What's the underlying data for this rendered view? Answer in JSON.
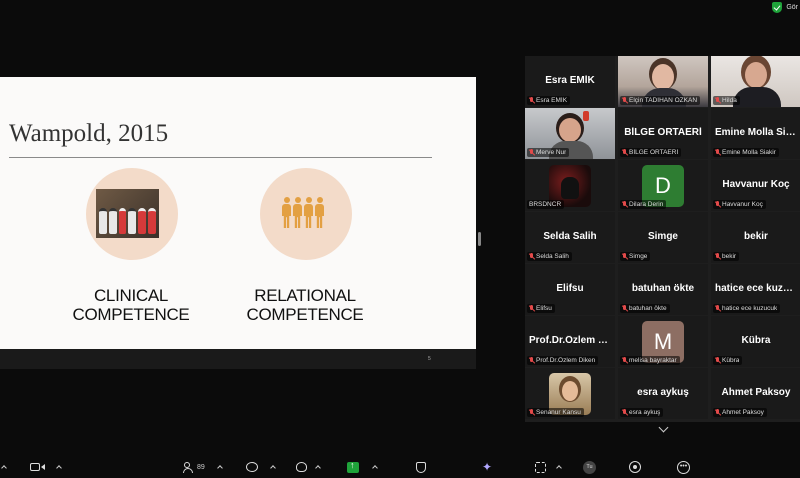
{
  "top_status": {
    "text": "Gör",
    "shield_icon": "shield-check-icon",
    "shield_color": "#1fa33a"
  },
  "slide": {
    "title": "Wampold, 2015",
    "left_label_line1": "CLINICAL",
    "left_label_line2": "COMPETENCE",
    "right_label_line1": "RELATIONAL",
    "right_label_line2": "COMPETENCE",
    "page_number": "5",
    "circle_color": "#f3dbc9",
    "people_icon_color": "#e3a043"
  },
  "gallery": {
    "tiles": [
      {
        "kind": "name",
        "display": "Esra EMİK",
        "label": "Esra EMİK"
      },
      {
        "kind": "video",
        "video": "v-elcin",
        "label": "Elçin TADIHAN ÖZKAN"
      },
      {
        "kind": "video",
        "video": "v-hilda",
        "label": "Hilda",
        "active": true
      },
      {
        "kind": "video",
        "video": "v-merve",
        "label": "Merve Nur"
      },
      {
        "kind": "name",
        "display": "BİLGE ORTAERİ",
        "label": "BİLGE ORTAERİ"
      },
      {
        "kind": "name",
        "display": "Emine Molla Siakir",
        "label": "Emine Molla Siakir"
      },
      {
        "kind": "avatar",
        "avatar": "av-brs",
        "label": "BRSDNCR",
        "muted": false
      },
      {
        "kind": "letter",
        "letter": "D",
        "letter_class": "lt-d",
        "label": "Dilara Derin"
      },
      {
        "kind": "name",
        "display": "Havvanur Koç",
        "label": "Havvanur Koç"
      },
      {
        "kind": "name",
        "display": "Selda Salih",
        "label": "Selda Salih"
      },
      {
        "kind": "name",
        "display": "Simge",
        "label": "Simge"
      },
      {
        "kind": "name",
        "display": "bekir",
        "label": "bekir"
      },
      {
        "kind": "name",
        "display": "Elifsu",
        "label": "Elifsu"
      },
      {
        "kind": "name",
        "display": "batuhan ökte",
        "label": "batuhan ökte"
      },
      {
        "kind": "name",
        "display": "hatice ece kuzucuk",
        "label": "hatice ece kuzucuk"
      },
      {
        "kind": "name",
        "display": "Prof.Dr.Özlem Diken",
        "label": "Prof.Dr.Özlem Diken"
      },
      {
        "kind": "letter",
        "letter": "M",
        "letter_class": "lt-m",
        "label": "melisa bayraktar"
      },
      {
        "kind": "name",
        "display": "Kübra",
        "label": "Kübra"
      },
      {
        "kind": "avatar",
        "avatar": "av-sena",
        "label": "Senanur Kansu"
      },
      {
        "kind": "name",
        "display": "esra aykuş",
        "label": "esra aykuş"
      },
      {
        "kind": "name",
        "display": "Ahmet Paksoy",
        "label": "Ahmet Paksoy"
      }
    ]
  },
  "toolbar": {
    "participants_count": "89",
    "avatar_initials": "Tu"
  }
}
